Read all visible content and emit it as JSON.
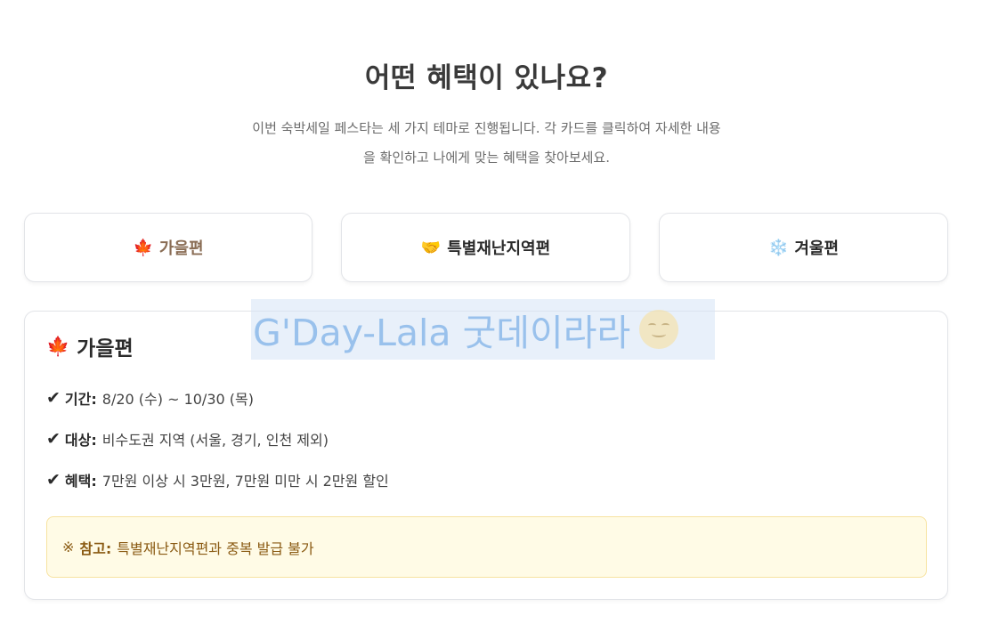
{
  "section": {
    "heading": "어떤 혜택이 있나요?",
    "intro_line1": "이번 숙박세일 페스타는 세 가지 테마로 진행됩니다. 각 카드를 클릭하여 자세한 내용",
    "intro_line2": "을 확인하고 나에게 맞는 혜택을 찾아보세요."
  },
  "tabs": [
    {
      "emoji": "🍁",
      "label": "가을편",
      "active": true
    },
    {
      "emoji": "🤝",
      "label": "특별재난지역편",
      "active": false
    },
    {
      "emoji": "❄️",
      "label": "겨울편",
      "active": false
    }
  ],
  "detail": {
    "emoji": "🍁",
    "title": "가을편",
    "check_symbol": "✔",
    "rows": [
      {
        "label": "기간:",
        "value": "8/20 (수) ~ 10/30 (목)"
      },
      {
        "label": "대상:",
        "value": "비수도권 지역 (서울, 경기, 인천 제외)"
      },
      {
        "label": "혜택:",
        "value": "7만원 이상 시 3만원, 7만원 미만 시 2만원 할인"
      }
    ],
    "note": {
      "symbol": "※",
      "label": "참고:",
      "text": "특별재난지역편과 중복 발급 불가"
    }
  },
  "watermark": {
    "text": "G'Day-Lala 굿데이라라"
  },
  "colors": {
    "active_tab_text": "#8a6d55",
    "note_background": "#fffbe6",
    "note_text": "#8a5a12",
    "card_border": "#e2e4e8"
  }
}
